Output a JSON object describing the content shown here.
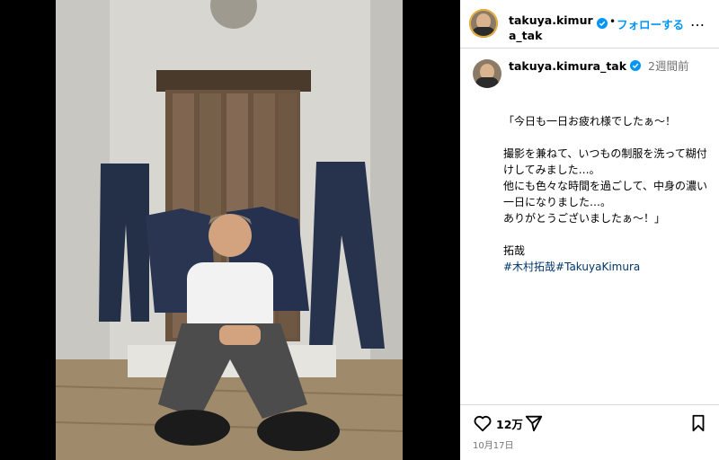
{
  "post": {
    "photo_alt": "",
    "author": {
      "username": "takuya.kimura_tak",
      "verified": true,
      "avatar_icon": "avatar-icon"
    },
    "follow_label": "フォローする",
    "separator": "•",
    "more_label": "…",
    "caption": {
      "username": "takuya.kimura_tak",
      "time_ago": "2週間前",
      "paragraphs": [
        "「今日も一日お疲れ様でしたぁ〜！",
        "撮影を兼ねて、いつもの制服を洗って糊付けしてみました…。\n他にも色々な時間を過ごして、中身の濃い一日になりました…。\nありがとうございましたぁ〜！」",
        "拓哉"
      ],
      "hashtags": "#木村拓哉#TakuyaKimura"
    },
    "likes": "12万",
    "date": "10月17日"
  },
  "colors": {
    "link": "#0095f6",
    "hashtag": "#00376b",
    "muted": "#737373",
    "border": "#dbdbdb"
  }
}
